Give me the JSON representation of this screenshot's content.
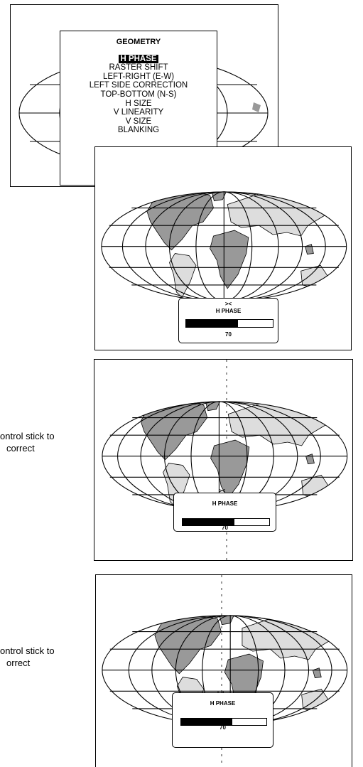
{
  "geometry_menu": {
    "title": "GEOMETRY",
    "items": [
      "H PHASE",
      "RASTER SHIFT",
      "LEFT-RIGHT (E-W)",
      "LEFT SIDE CORRECTION",
      "TOP-BOTTOM (N-S)",
      "H SIZE",
      "V LINEARITY",
      "V SIZE",
      "BLANKING"
    ],
    "selected_index": 0
  },
  "panel1": {
    "marker": "><",
    "label": "H PHASE",
    "value": "70",
    "fill_fraction": 0.6
  },
  "panel2": {
    "marker": "><",
    "label": "H PHASE",
    "value": "70",
    "fill_fraction": 0.6,
    "side_text_line1": "ontrol stick to",
    "side_text_line2": "correct"
  },
  "panel3": {
    "marker": "><",
    "label": "H PHASE",
    "value": "70",
    "fill_fraction": 0.6,
    "side_text_line1": "ontrol stick to",
    "side_text_line2": "orrect"
  },
  "colors": {
    "land_dark": "#999999",
    "land_light": "#dddddd",
    "line": "#000000"
  }
}
